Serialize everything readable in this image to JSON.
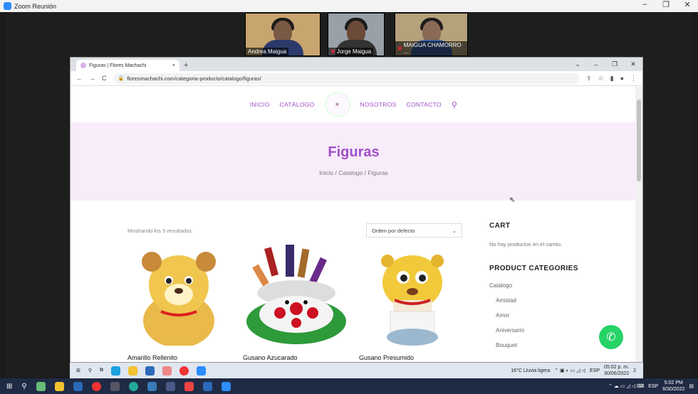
{
  "zoom": {
    "title": "Zoom Reunión",
    "controls": [
      "–",
      "❐",
      "✕"
    ]
  },
  "participants": [
    {
      "name": "Andrea Maigua",
      "muted": false
    },
    {
      "name": "Jorge Maigua",
      "muted": true
    },
    {
      "name": "MAIGUA CHAMORRO ...",
      "muted": true
    }
  ],
  "browser": {
    "tab_title": "Figuras | Flores Machachi",
    "tab_close": "×",
    "new_tab": "+",
    "url": "floresmachachi.com/categoria-producto/catalogo/figuras/",
    "win_controls": [
      "⌄",
      "–",
      "❐",
      "✕"
    ]
  },
  "site": {
    "nav": [
      "INICIO",
      "CATÁLOGO",
      "NOSOTROS",
      "CONTACTO"
    ],
    "hero_title": "Figuras",
    "breadcrumb": "Inicio / Catalogo / Figuras",
    "result_count": "Mostrando los 5 resultados",
    "sort_label": "Orden por defecto",
    "products": [
      "Amarillo Rellenito",
      "Gusano Azucarado",
      "Gusano Presumido"
    ],
    "cart_heading": "CART",
    "cart_empty": "No hay productos en el carrito.",
    "categories_heading": "PRODUCT CATEGORIES",
    "categories": [
      {
        "label": "Catalogo",
        "sub": false
      },
      {
        "label": "Amistad",
        "sub": true
      },
      {
        "label": "Amor",
        "sub": true
      },
      {
        "label": "Aniversario",
        "sub": true
      },
      {
        "label": "Bouquet",
        "sub": true
      }
    ]
  },
  "inner_tray": {
    "weather": "16°C  Lluvia ligera",
    "lang": "ESP",
    "time": "05:02 p. m.",
    "date": "30/06/2022",
    "notif": "2"
  },
  "outer_tray": {
    "lang": "ESP",
    "time": "5:02 PM",
    "date": "6/30/2022"
  }
}
